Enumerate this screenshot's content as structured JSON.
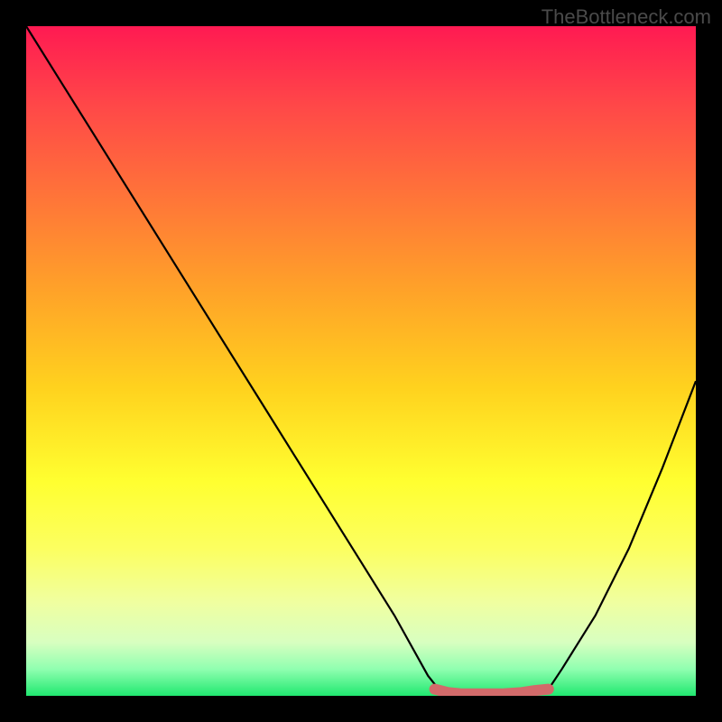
{
  "watermark": "TheBottleneck.com",
  "chart_data": {
    "type": "line",
    "title": "",
    "xlabel": "",
    "ylabel": "",
    "xlim": [
      0,
      100
    ],
    "ylim": [
      0,
      100
    ],
    "series": [
      {
        "name": "bottleneck-curve",
        "x": [
          0,
          5,
          10,
          15,
          20,
          25,
          30,
          35,
          40,
          45,
          50,
          55,
          60,
          62,
          65,
          70,
          75,
          78,
          80,
          85,
          90,
          95,
          100
        ],
        "y": [
          100,
          92,
          84,
          76,
          68,
          60,
          52,
          44,
          36,
          28,
          20,
          12,
          3,
          0.5,
          0.2,
          0.2,
          0.5,
          1,
          4,
          12,
          22,
          34,
          47
        ]
      },
      {
        "name": "flat-zone-marker",
        "x": [
          61,
          63,
          65,
          68,
          71,
          74,
          76,
          78
        ],
        "y": [
          1.0,
          0.5,
          0.3,
          0.3,
          0.3,
          0.5,
          0.8,
          1.0
        ]
      }
    ],
    "gradient_stops": [
      {
        "pos": 0.0,
        "color": "#ff1a52"
      },
      {
        "pos": 0.12,
        "color": "#ff4848"
      },
      {
        "pos": 0.26,
        "color": "#ff7638"
      },
      {
        "pos": 0.4,
        "color": "#ffa428"
      },
      {
        "pos": 0.54,
        "color": "#ffd21e"
      },
      {
        "pos": 0.68,
        "color": "#ffff30"
      },
      {
        "pos": 0.78,
        "color": "#fcff60"
      },
      {
        "pos": 0.86,
        "color": "#f0ffa0"
      },
      {
        "pos": 0.92,
        "color": "#d8ffc0"
      },
      {
        "pos": 0.96,
        "color": "#90ffb0"
      },
      {
        "pos": 1.0,
        "color": "#20e870"
      }
    ],
    "marker_color": "#d26a6a",
    "curve_color": "#000000"
  }
}
